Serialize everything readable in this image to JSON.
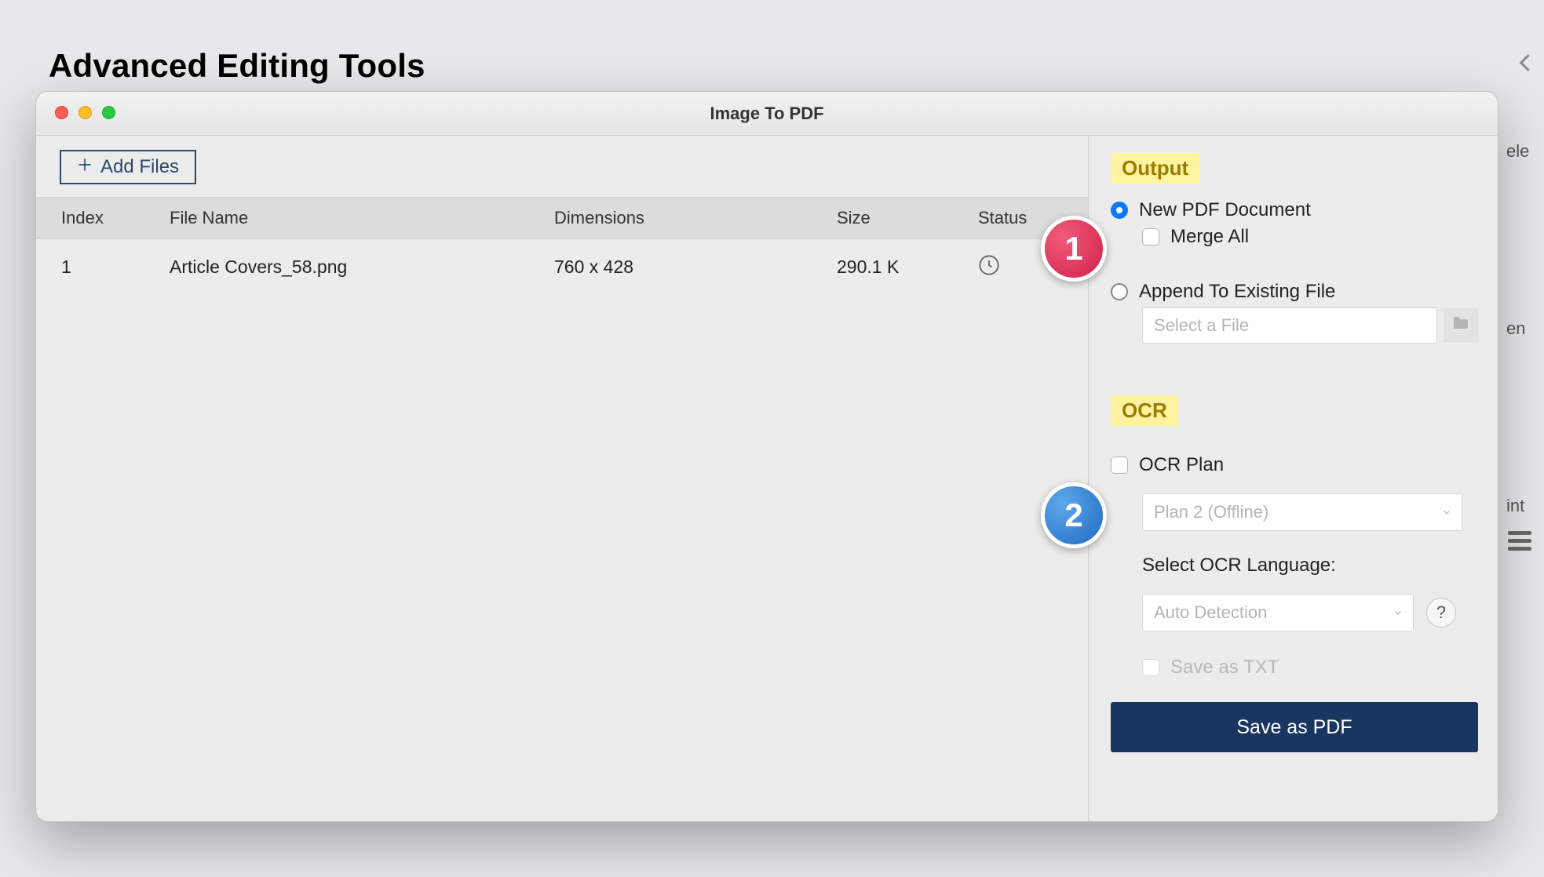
{
  "page": {
    "title": "Advanced Editing Tools"
  },
  "window": {
    "title": "Image To PDF",
    "toolbar": {
      "add_files_label": "Add Files"
    },
    "table": {
      "headers": {
        "index": "Index",
        "file_name": "File Name",
        "dimensions": "Dimensions",
        "size": "Size",
        "status": "Status"
      },
      "rows": [
        {
          "index": "1",
          "file_name": "Article Covers_58.png",
          "dimensions": "760 x 428",
          "size": "290.1 K",
          "status_icon": "clock"
        }
      ]
    }
  },
  "sidebar": {
    "output": {
      "heading": "Output",
      "new_pdf_label": "New PDF Document",
      "new_pdf_selected": true,
      "merge_all_label": "Merge All",
      "merge_all_checked": false,
      "append_label": "Append To Existing File",
      "append_selected": false,
      "append_file_placeholder": "Select a File"
    },
    "ocr": {
      "heading": "OCR",
      "ocr_plan_label": "OCR Plan",
      "ocr_plan_checked": false,
      "ocr_plan_select_value": "Plan 2 (Offline)",
      "language_label": "Select OCR Language:",
      "language_select_value": "Auto Detection",
      "help_symbol": "?",
      "save_txt_label": "Save as TXT",
      "save_txt_checked": false
    },
    "primary_button": "Save as PDF"
  },
  "annotations": {
    "badge1": "1",
    "badge2": "2"
  },
  "obscured": {
    "t1": "ele",
    "t2": "en",
    "t3": "int"
  }
}
